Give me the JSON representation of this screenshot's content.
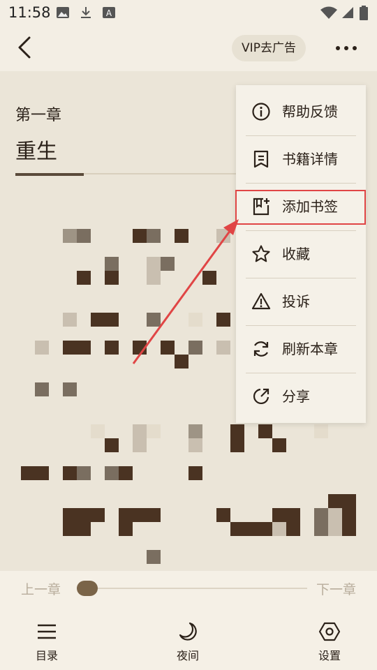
{
  "status_bar": {
    "time": "11:58",
    "icons": [
      "image-icon",
      "download-icon",
      "font-icon",
      "wifi-icon",
      "signal-icon",
      "battery-icon"
    ]
  },
  "header": {
    "vip_label": "VIP去广告",
    "back_icon": "chevron-left-icon",
    "more_icon": "more-dots-icon"
  },
  "chapter": {
    "number": "第一章",
    "title": "重生"
  },
  "menu": {
    "items": [
      {
        "label": "帮助反馈",
        "icon": "info-icon"
      },
      {
        "label": "书籍详情",
        "icon": "book-detail-icon"
      },
      {
        "label": "添加书签",
        "icon": "add-bookmark-icon",
        "highlighted": true
      },
      {
        "label": "收藏",
        "icon": "star-icon"
      },
      {
        "label": "投诉",
        "icon": "warning-icon"
      },
      {
        "label": "刷新本章",
        "icon": "refresh-icon"
      },
      {
        "label": "分享",
        "icon": "share-icon"
      }
    ]
  },
  "progress": {
    "prev": "上一章",
    "next": "下一章",
    "value": 0.0
  },
  "bottom_nav": {
    "items": [
      {
        "label": "目录",
        "icon": "menu-list-icon"
      },
      {
        "label": "夜间",
        "icon": "moon-icon"
      },
      {
        "label": "设置",
        "icon": "settings-hexagon-icon"
      }
    ]
  },
  "colors": {
    "accent_red": "#e04545",
    "brown": "#4a3828",
    "background": "#f5f0e6"
  }
}
